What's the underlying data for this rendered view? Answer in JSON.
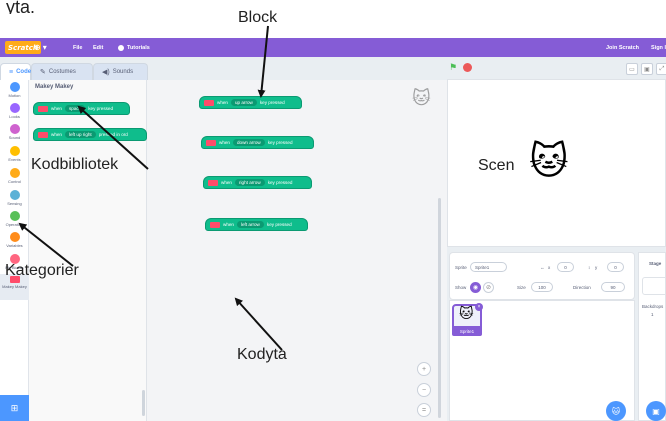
{
  "cropped_text": "yta.",
  "menubar": {
    "logo": "Scratch",
    "globe_icon": "globe-icon",
    "file": "File",
    "edit": "Edit",
    "tutorials": "Tutorials",
    "join": "Join Scratch",
    "sign_in": "Sign I",
    "color": "#855cd6"
  },
  "tabs": {
    "code": "Code",
    "costumes": "Costumes",
    "sounds": "Sounds"
  },
  "categories": [
    {
      "label": "Motion",
      "color": "#4c97ff"
    },
    {
      "label": "Looks",
      "color": "#9966ff"
    },
    {
      "label": "Sound",
      "color": "#cf63cf"
    },
    {
      "label": "Events",
      "color": "#ffbf00"
    },
    {
      "label": "Control",
      "color": "#ffab19"
    },
    {
      "label": "Sensing",
      "color": "#5cb1d6"
    },
    {
      "label": "Operators",
      "color": "#59c059"
    },
    {
      "label": "Variables",
      "color": "#ff8c1a"
    },
    {
      "label": "My Blocks",
      "color": "#ff6680"
    },
    {
      "label": "Makey Makey",
      "color": "#ff4c6a"
    }
  ],
  "palette": {
    "title": "Makey Makey",
    "blocks": [
      {
        "when": "when",
        "key": "space",
        "suffix": "key pressed"
      },
      {
        "when": "when",
        "key": "left up right",
        "suffix": "pressed in ord"
      }
    ]
  },
  "workspace": {
    "blocks": [
      {
        "when": "when",
        "key": "up arrow",
        "suffix": "key pressed"
      },
      {
        "when": "when",
        "key": "down arrow",
        "suffix": "key pressed"
      },
      {
        "when": "when",
        "key": "right arrow",
        "suffix": "key pressed"
      },
      {
        "when": "when",
        "key": "left arrow",
        "suffix": "key pressed"
      }
    ],
    "zoom_in": "+",
    "zoom_out": "−",
    "zoom_reset": "="
  },
  "sprite_info": {
    "sprite_label": "Sprite",
    "sprite_name": "Sprite1",
    "x_label": "x",
    "x_value": "0",
    "y_label": "y",
    "y_value": "0",
    "show_label": "Show",
    "size_label": "Size",
    "size_value": "100",
    "direction_label": "Direction",
    "direction_value": "90"
  },
  "sprite_list": {
    "thumb_label": "Sprite1"
  },
  "stage_panel": {
    "title": "Stage",
    "backdrops_label": "Backdrops",
    "backdrops_count": "1"
  },
  "annotations": {
    "block": "Block",
    "library": "Kodbibliotek",
    "scene": "Scen",
    "categories": "Kategorier",
    "code_area": "Kodyta"
  }
}
